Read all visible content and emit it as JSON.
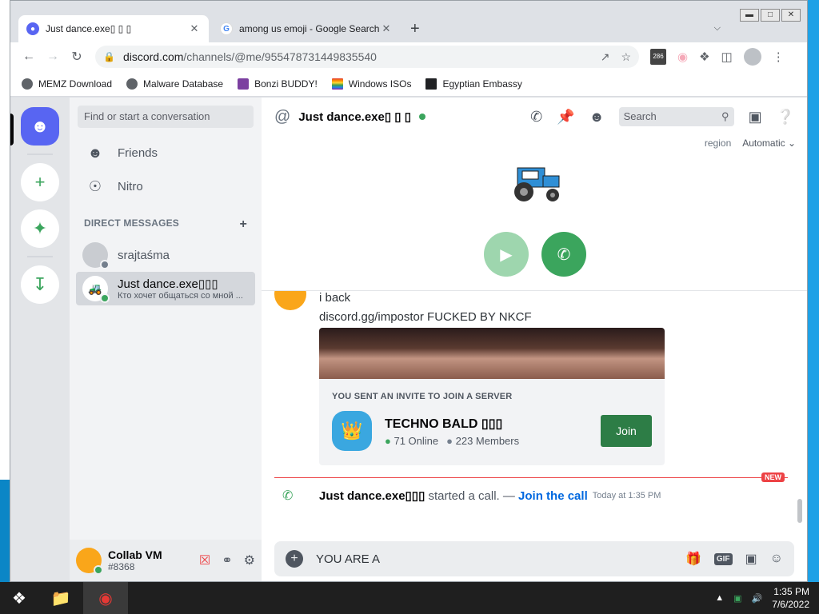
{
  "browser": {
    "tabs": [
      {
        "title": "Just dance.exe▯ ▯ ▯",
        "close": "✕"
      },
      {
        "title": "among us emoji - Google Search",
        "close": "✕"
      }
    ],
    "new_tab": "+",
    "url_domain": "discord.com",
    "url_path": "/channels/@me/955478731449835540",
    "ext_badge": "286",
    "bookmarks": [
      {
        "label": "MEMZ Download",
        "color": "#5f6368"
      },
      {
        "label": "Malware Database",
        "color": "#5f6368"
      },
      {
        "label": "Bonzi BUDDY!",
        "color": "#7b3fa0"
      },
      {
        "label": "Windows ISOs",
        "color": "#e53935"
      },
      {
        "label": "Egyptian Embassy",
        "color": "#202124"
      }
    ]
  },
  "discord": {
    "search_placeholder": "Find or start a conversation",
    "nav": {
      "friends": "Friends",
      "nitro": "Nitro"
    },
    "dm_header": "DIRECT MESSAGES",
    "dm_add": "+",
    "dms": [
      {
        "name": "srajtaśma",
        "status": "",
        "online": false
      },
      {
        "name": "Just dance.exe▯▯▯",
        "status": "Кто хочет общаться со мной ...",
        "online": true
      }
    ],
    "user": {
      "name": "Collab VM",
      "tag": "#8368"
    },
    "channel": {
      "title": "Just dance.exe▯ ▯ ▯",
      "search": "Search"
    },
    "region": {
      "label": "region",
      "value": "Automatic"
    },
    "messages": {
      "line1": "i back",
      "line2": "discord.gg/impostor FUCKED BY NKCF"
    },
    "invite": {
      "header": "YOU SENT AN INVITE TO JOIN A SERVER",
      "server": "TECHNO BALD ▯▯▯",
      "online": "71 Online",
      "members": "223 Members",
      "join": "Join"
    },
    "new_tag": "NEW",
    "system": {
      "who": "Just dance.exe▯▯▯",
      "action": " started a call. — ",
      "link": "Join the call",
      "time": "Today at 1:35 PM"
    },
    "composer": {
      "text": "YOU ARE A ",
      "gif": "GIF"
    }
  },
  "taskbar": {
    "time": "1:35 PM",
    "date": "7/6/2022"
  }
}
